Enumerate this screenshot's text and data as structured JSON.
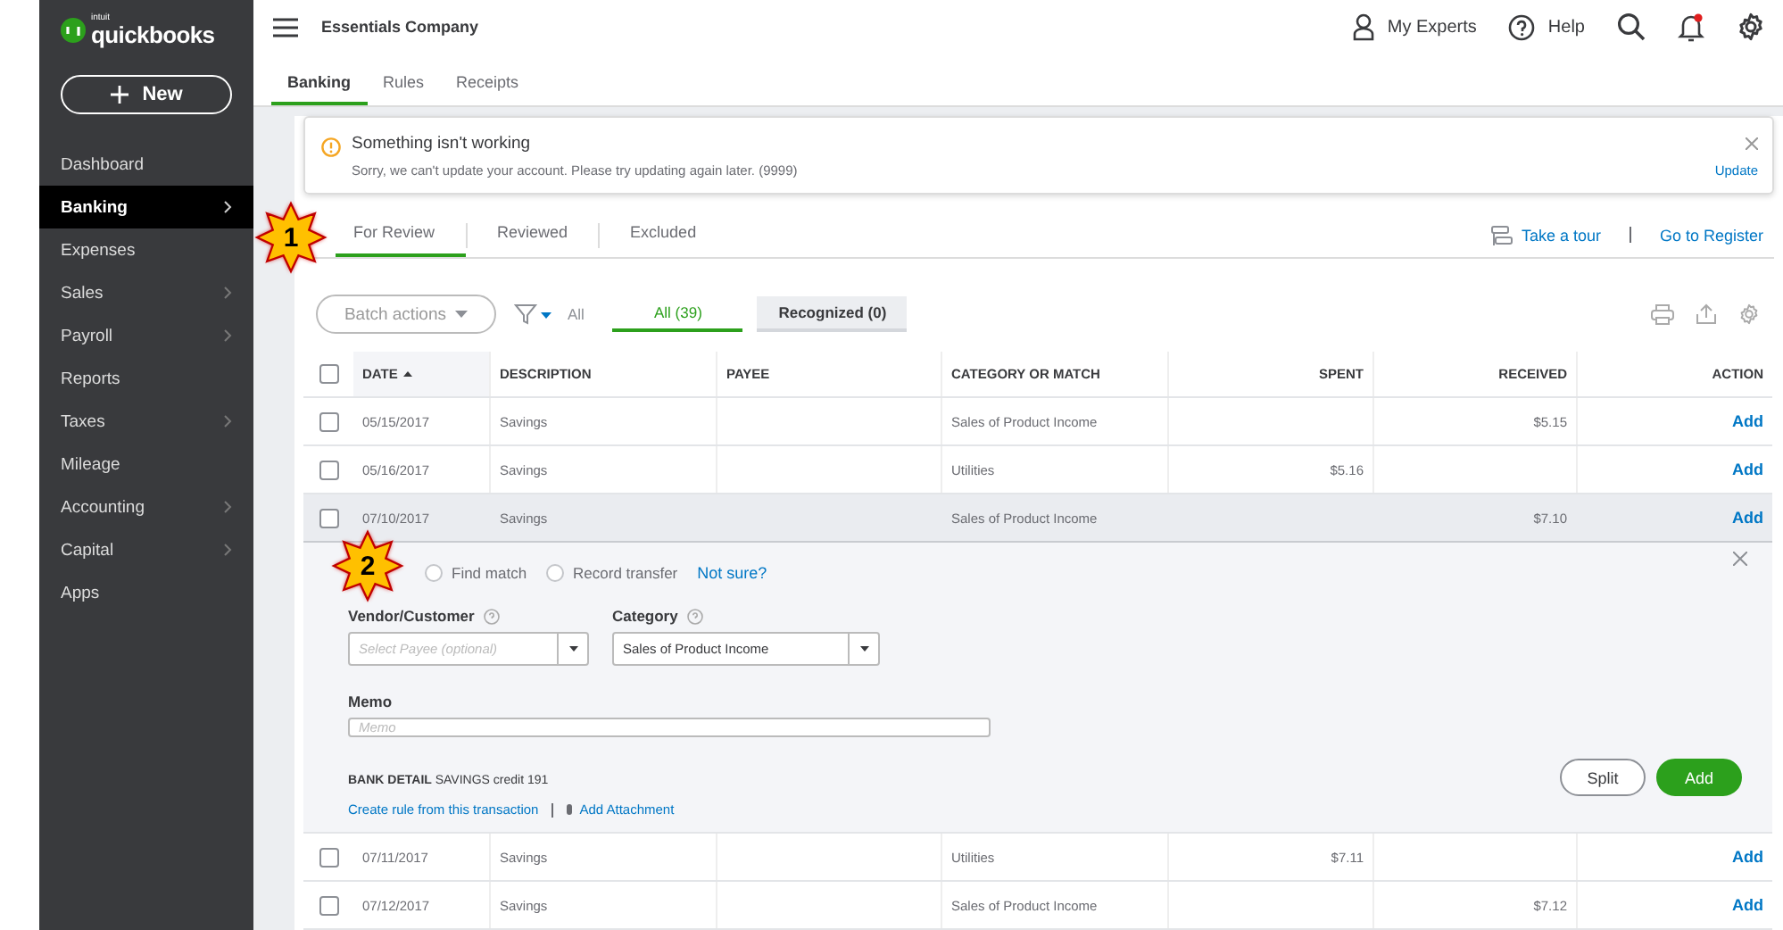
{
  "logo": {
    "brand": "intuit",
    "name": "quickbooks"
  },
  "sidebar": {
    "new_button": "New",
    "items": [
      {
        "label": "Dashboard",
        "selected": false,
        "has_submenu": false
      },
      {
        "label": "Banking",
        "selected": true,
        "has_submenu": true
      },
      {
        "label": "Expenses",
        "selected": false,
        "has_submenu": false
      },
      {
        "label": "Sales",
        "selected": false,
        "has_submenu": true
      },
      {
        "label": "Payroll",
        "selected": false,
        "has_submenu": true
      },
      {
        "label": "Reports",
        "selected": false,
        "has_submenu": false
      },
      {
        "label": "Taxes",
        "selected": false,
        "has_submenu": true
      },
      {
        "label": "Mileage",
        "selected": false,
        "has_submenu": false
      },
      {
        "label": "Accounting",
        "selected": false,
        "has_submenu": true
      },
      {
        "label": "Capital",
        "selected": false,
        "has_submenu": true
      },
      {
        "label": "Apps",
        "selected": false,
        "has_submenu": false
      }
    ]
  },
  "header": {
    "company": "Essentials Company",
    "actions": [
      {
        "kind": "experts",
        "label": "My Experts"
      },
      {
        "kind": "help",
        "label": "Help"
      },
      {
        "kind": "search"
      },
      {
        "kind": "notifications",
        "unread": true
      },
      {
        "kind": "settings"
      }
    ]
  },
  "tabs": [
    {
      "label": "Banking",
      "selected": true
    },
    {
      "label": "Rules",
      "selected": false
    },
    {
      "label": "Receipts",
      "selected": false
    }
  ],
  "alert": {
    "title": "Something isn't working",
    "message": "Sorry, we can't update your account. Please try updating again later. (9999)",
    "action": "Update"
  },
  "review_tabs": [
    {
      "label": "For Review",
      "selected": true
    },
    {
      "label": "Reviewed",
      "selected": false
    },
    {
      "label": "Excluded",
      "selected": false
    }
  ],
  "links": [
    {
      "label": "Take a tour"
    },
    {
      "label": "Go to Register"
    }
  ],
  "toolbar": {
    "batch": "Batch actions",
    "filter_label": "All",
    "chips": [
      {
        "label": "All (39)",
        "selected": true
      },
      {
        "label": "Recognized (0)",
        "selected": false
      }
    ]
  },
  "table": {
    "all_checked": false,
    "columns": [
      "DATE",
      "DESCRIPTION",
      "PAYEE",
      "CATEGORY OR MATCH",
      "SPENT",
      "RECEIVED",
      "ACTION"
    ],
    "rows": [
      {
        "checked": false,
        "expanded": false,
        "date": "05/15/2017",
        "description": "Savings",
        "category": "Sales of Product Income",
        "received": "$5.15",
        "action": "Add"
      },
      {
        "checked": false,
        "expanded": false,
        "date": "05/16/2017",
        "description": "Savings",
        "category": "Utilities",
        "spent": "$5.16",
        "action": "Add"
      },
      {
        "checked": false,
        "expanded": true,
        "date": "07/10/2017",
        "description": "Savings",
        "category": "Sales of Product Income",
        "received": "$7.10",
        "action": "Add",
        "detail": {
          "options": [
            {
              "label": "Find match",
              "selected": false
            },
            {
              "label": "Record transfer",
              "selected": false
            }
          ],
          "help_link": "Not sure?",
          "vendor_label": "Vendor/Customer",
          "vendor_placeholder": "Select Payee (optional)",
          "category_label": "Category",
          "category_value": "Sales of Product Income",
          "memo_label": "Memo",
          "memo_placeholder": "Memo",
          "bank_detail_label": "BANK DETAIL",
          "bank_detail": "SAVINGS credit 191",
          "rule_link": "Create rule from this transaction",
          "attachment_link": "Add Attachment",
          "buttons": [
            "Split",
            "Add"
          ]
        }
      },
      {
        "checked": false,
        "expanded": false,
        "date": "07/11/2017",
        "description": "Savings",
        "category": "Utilities",
        "spent": "$7.11",
        "action": "Add"
      },
      {
        "checked": false,
        "expanded": false,
        "date": "07/12/2017",
        "description": "Savings",
        "category": "Sales of Product Income",
        "received": "$7.12",
        "action": "Add"
      }
    ]
  },
  "callouts": [
    {
      "label": "1"
    },
    {
      "label": "2"
    }
  ]
}
